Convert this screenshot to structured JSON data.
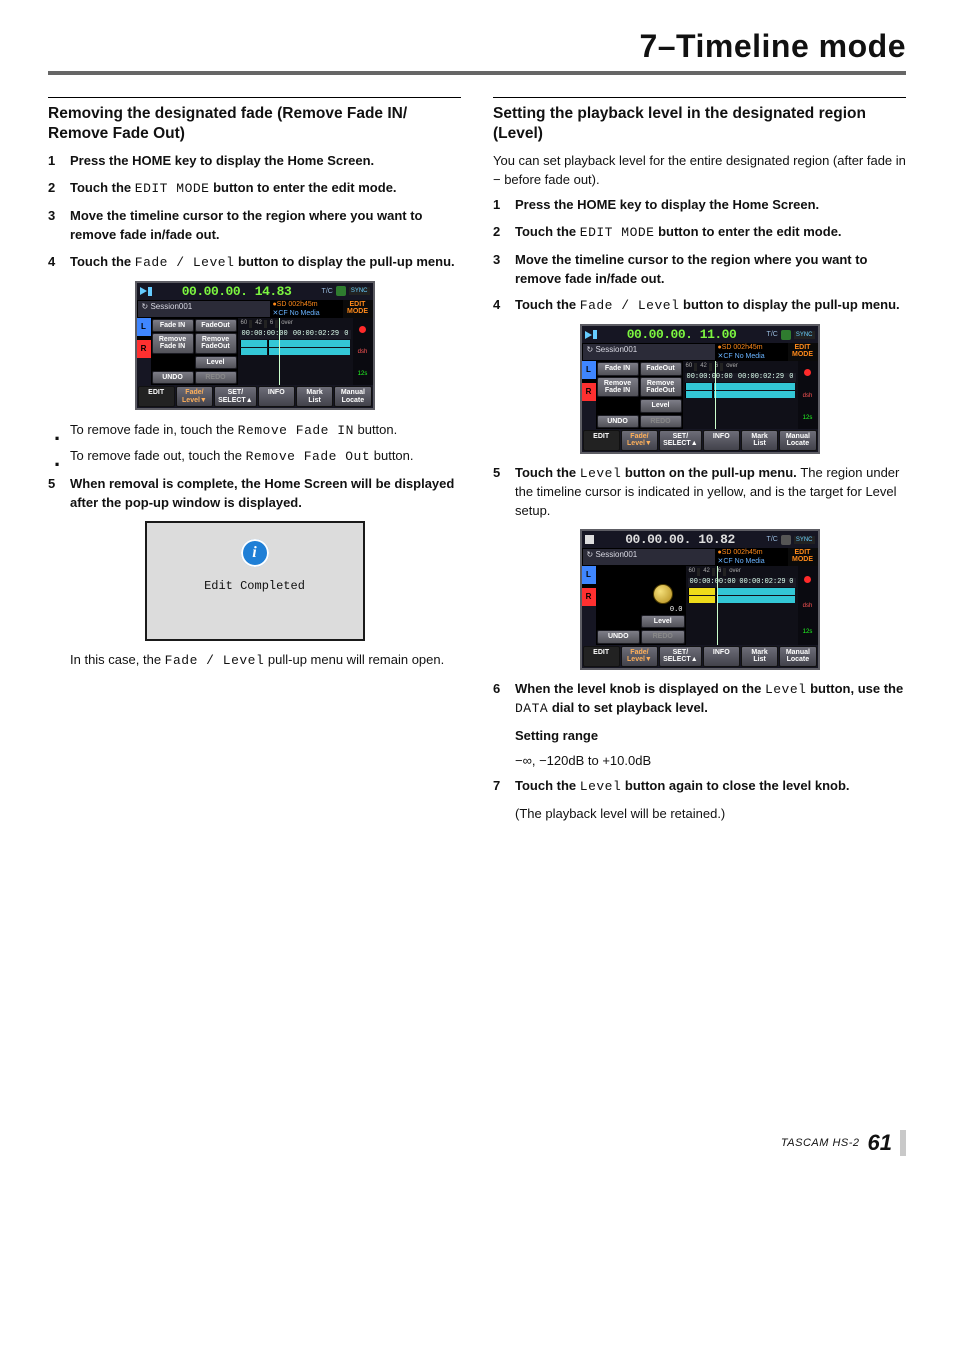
{
  "page_title": "7–Timeline mode",
  "footer": {
    "model": "TASCAM HS-2",
    "page": "61"
  },
  "left": {
    "heading": "Removing the designated fade (Remove Fade IN/ Remove Fade Out)",
    "steps": {
      "s1": "Press the HOME key to display the Home Screen.",
      "s2a": "Touch the ",
      "s2b": "EDIT MODE",
      "s2c": " button to enter the edit mode.",
      "s3": "Move the timeline cursor to the region where you want to remove fade in/fade out.",
      "s4a": "Touch the ",
      "s4b": "Fade / Level",
      "s4c": " button to display the pull-up menu."
    },
    "bullets": {
      "b1a": "To remove fade in, touch the ",
      "b1b": "Remove Fade IN",
      "b1c": " button.",
      "b2a": "To remove fade out, touch the ",
      "b2b": "Remove Fade Out",
      "b2c": " button."
    },
    "step5": "When removal is complete, the Home Screen will be displayed after the pop-up window is displayed.",
    "edit_completed": "Edit Completed",
    "after_pa": "In this case, the ",
    "after_pb": "Fade / Level",
    "after_pc": " pull-up menu will remain open."
  },
  "right": {
    "heading": "Setting the playback level in the designated region (Level)",
    "intro": "You can set playback level for the entire designated region (after fade in − before fade out).",
    "steps": {
      "s1": "Press the HOME key to display the Home Screen.",
      "s2a": "Touch the ",
      "s2b": "EDIT MODE",
      "s2c": " button to enter the edit mode.",
      "s3": "Move the timeline cursor to the region where you want to remove fade in/fade out.",
      "s4a": "Touch the ",
      "s4b": "Fade / Level",
      "s4c": " button to display the pull-up menu.",
      "s5a": "Touch the ",
      "s5b": "Level",
      "s5c": " button on the pull-up menu. ",
      "s5_norm": "The region under the timeline cursor is indicated in yellow, and is the target for Level setup.",
      "s6a": "When the level knob is displayed on the ",
      "s6b": "Level",
      "s6c": " button, use the ",
      "s6d": "DATA",
      "s6e": " dial to set playback level.",
      "range_title": "Setting range",
      "range_val": "−∞, −120dB to +10.0dB",
      "s7a": "Touch the ",
      "s7b": "Level",
      "s7c": " button again to close the level knob.",
      "s7_norm": "(The playback level will be retained.)"
    }
  },
  "dev_shared": {
    "session": "Session001",
    "sd1": "●SD  002h45m",
    "sd2": "✕CF  No Media",
    "editmode1": "EDIT",
    "editmode2": "MODE",
    "ts_start": "00:00:00:00",
    "ts_end": "00:00:02:29",
    "ts_extra": "0",
    "meter_labels": {
      "a": "60",
      "b": "42",
      "c": "6",
      "d": "over"
    },
    "dsh": "dsh",
    "rate": "12s",
    "btns": {
      "fadein": "Fade IN",
      "fadeout": "FadeOut",
      "rfadein1": "Remove",
      "rfadein2": "Fade IN",
      "rfadeout1": "Remove",
      "rfadeout2": "FadeOut",
      "level": "Level",
      "undo": "UNDO",
      "redo": "REDO"
    },
    "bot": {
      "edit": "EDIT",
      "fade": "Fade/",
      "fade2": "Level▼",
      "sel": "SET/",
      "sel2": "SELECT▲",
      "info": "INFO",
      "mark1": "Mark",
      "mark2": "List",
      "man1": "Manual",
      "man2": "Locate"
    },
    "sync": "SYNC",
    "tc": "T/C"
  },
  "dev1": {
    "digits": "00.00.00. 14.83"
  },
  "dev2": {
    "digits": "00.00.00. 11.00"
  },
  "dev3": {
    "digits": "00.00.00. 10.82",
    "levelval": "0.0"
  }
}
